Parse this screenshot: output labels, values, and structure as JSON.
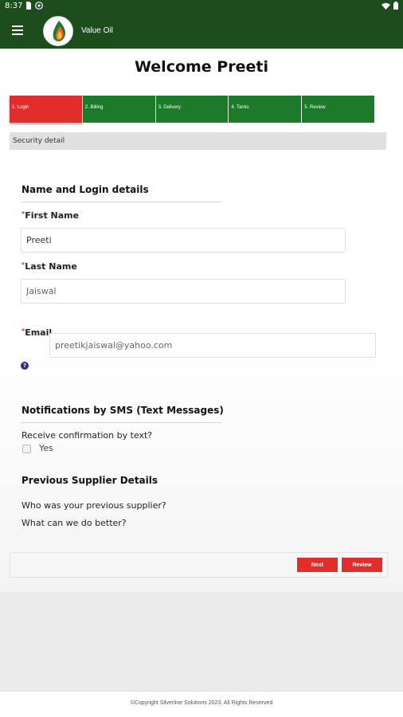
{
  "status_bar": {
    "time": "8:37"
  },
  "app_bar": {
    "title": "Value Oil"
  },
  "page": {
    "welcome": "Welcome Preeti"
  },
  "steps": [
    {
      "label": "1. Login",
      "active": true
    },
    {
      "label": "2. Billing",
      "active": false
    },
    {
      "label": "3. Delivery",
      "active": false
    },
    {
      "label": "4. Tanks",
      "active": false
    },
    {
      "label": "5. Review",
      "active": false
    }
  ],
  "section_bar": {
    "label": "Security detail"
  },
  "login_details": {
    "heading": "Name and Login details",
    "first_name": {
      "label": "First Name",
      "value": "Preeti"
    },
    "last_name": {
      "label": "Last Name",
      "value": "Jaiswal"
    },
    "email": {
      "label": "Email",
      "value": "preetikjaiswal@yahoo.com"
    },
    "help_icon": "?"
  },
  "notifications": {
    "heading": "Notifications by SMS (Text Messages)",
    "question": "Receive confirmation by text?",
    "option_label": "Yes"
  },
  "supplier": {
    "heading": "Previous Supplier Details",
    "q1": "Who was your previous supplier?",
    "q2": "What can we do better?"
  },
  "actions": {
    "next": "Next",
    "review": "Review"
  },
  "footer": {
    "text": "©Copyright Silverline Solutions 2023. All Rights Reserved"
  },
  "colors": {
    "brand_green": "#1d4d1d",
    "step_green": "#1e7a2b",
    "accent_red": "#e22d2d"
  }
}
